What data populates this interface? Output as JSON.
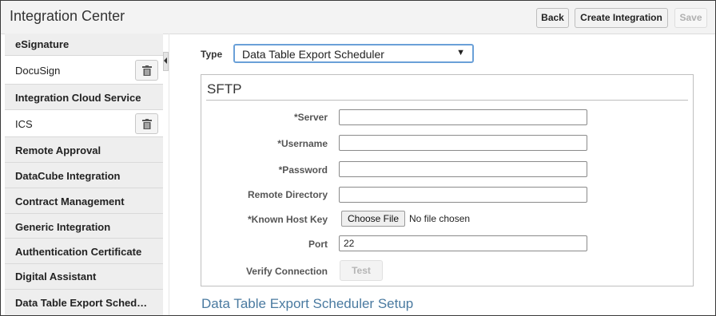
{
  "header": {
    "title": "Integration Center",
    "back_label": "Back",
    "create_label": "Create Integration",
    "save_label": "Save"
  },
  "sidebar": {
    "items": [
      {
        "label": "eSignature",
        "kind": "group"
      },
      {
        "label": "DocuSign",
        "kind": "sub",
        "delete_icon": "trash-icon"
      },
      {
        "label": "Integration Cloud Service",
        "kind": "group"
      },
      {
        "label": "ICS",
        "kind": "sub",
        "delete_icon": "trash-icon"
      },
      {
        "label": "Remote Approval",
        "kind": "group"
      },
      {
        "label": "DataCube Integration",
        "kind": "group"
      },
      {
        "label": "Contract Management",
        "kind": "group"
      },
      {
        "label": "Generic Integration",
        "kind": "group"
      },
      {
        "label": "Authentication Certificate",
        "kind": "group"
      },
      {
        "label": "Digital Assistant",
        "kind": "group"
      },
      {
        "label": "Data Table Export Sched…",
        "kind": "group"
      }
    ]
  },
  "form": {
    "type_label": "Type",
    "type_value": "Data Table Export Scheduler",
    "type_caret": "▼",
    "sftp": {
      "title": "SFTP",
      "server_label": "*Server",
      "server_value": "",
      "username_label": "*Username",
      "username_value": "",
      "password_label": "*Password",
      "password_value": "",
      "remote_dir_label": "Remote Directory",
      "remote_dir_value": "",
      "known_host_label": "*Known Host Key",
      "choose_file_label": "Choose File",
      "file_status": "No file chosen",
      "port_label": "Port",
      "port_value": "22",
      "verify_label": "Verify Connection",
      "test_label": "Test"
    },
    "setup_title": "Data Table Export Scheduler Setup"
  },
  "colors": {
    "accent_link": "#4a7aa0",
    "select_focus": "#6aa0d8",
    "sidebar_group_bg": "#eeeeee"
  }
}
